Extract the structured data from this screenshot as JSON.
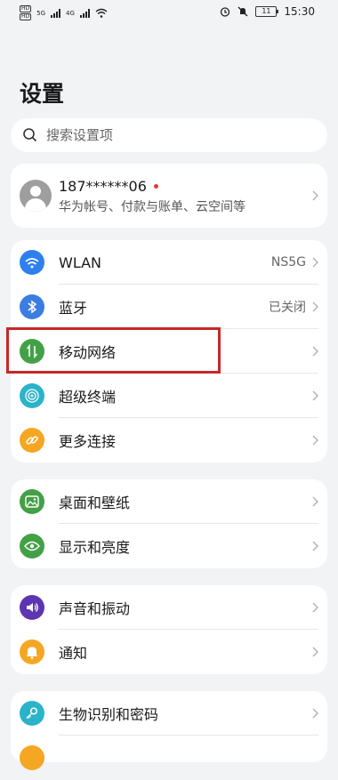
{
  "status": {
    "time": "15:30",
    "battery": "11",
    "net1": "4G",
    "net2": "5G"
  },
  "page_title": "设置",
  "search": {
    "placeholder": "搜索设置项"
  },
  "account": {
    "phone": "187******06",
    "subtitle": "华为帐号、付款与账单、云空间等"
  },
  "group1": [
    {
      "label": "WLAN",
      "value": "NS5G",
      "icon": "wifi-icon",
      "color": "#2f80ed"
    },
    {
      "label": "蓝牙",
      "value": "已关闭",
      "icon": "bluetooth-icon",
      "color": "#3b7de0"
    },
    {
      "label": "移动网络",
      "value": "",
      "icon": "mobile-data-icon",
      "color": "#43a047"
    },
    {
      "label": "超级终端",
      "value": "",
      "icon": "super-device-icon",
      "color": "#2bb3c9"
    },
    {
      "label": "更多连接",
      "value": "",
      "icon": "link-icon",
      "color": "#f5a623"
    }
  ],
  "group2": [
    {
      "label": "桌面和壁纸",
      "icon": "wallpaper-icon",
      "color": "#43a047"
    },
    {
      "label": "显示和亮度",
      "icon": "eye-icon",
      "color": "#43a047"
    }
  ],
  "group3": [
    {
      "label": "声音和振动",
      "icon": "sound-icon",
      "color": "#5e35b1"
    },
    {
      "label": "通知",
      "icon": "bell-icon",
      "color": "#f5a623"
    }
  ],
  "group4": [
    {
      "label": "生物识别和密码",
      "icon": "key-icon",
      "color": "#2bb3c9"
    }
  ]
}
